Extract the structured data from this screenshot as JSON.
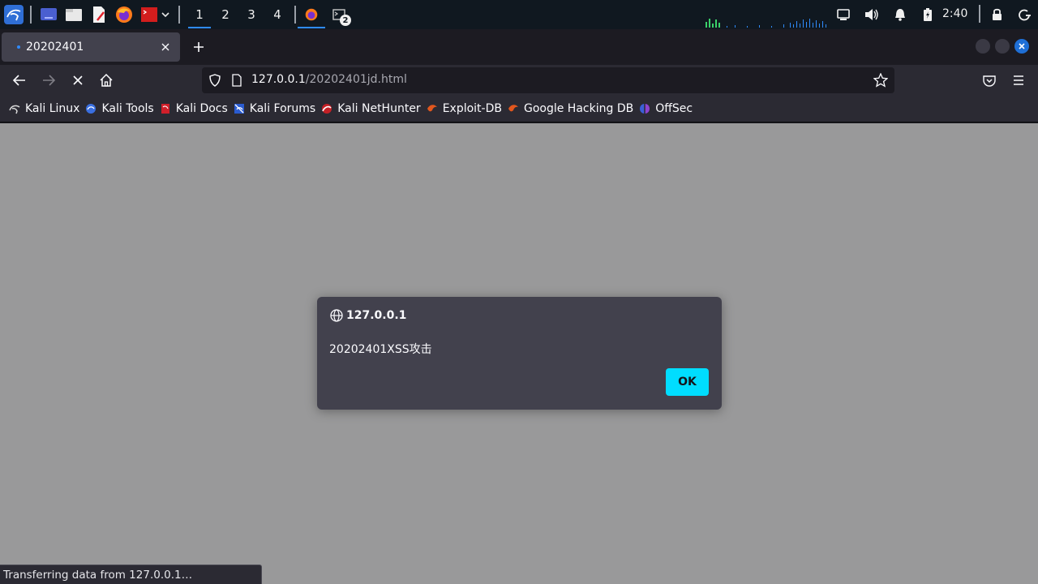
{
  "taskbar": {
    "workspaces": [
      "1",
      "2",
      "3",
      "4"
    ],
    "active_workspace": "1",
    "terminal_badge": "2",
    "clock": "2:40",
    "accent": "#2f8bff",
    "launcher_icons": [
      "kali-menu-icon",
      "show-desktop-icon",
      "file-manager-icon",
      "text-editor-icon",
      "firefox-icon",
      "terminal-icon",
      "chevron-down-icon"
    ],
    "tray_icons": [
      "network-icon",
      "volume-icon",
      "notification-bell-icon",
      "battery-icon",
      "lock-icon",
      "logout-icon"
    ]
  },
  "browser": {
    "tab": {
      "title": "20202401",
      "loading": true
    },
    "url": {
      "host": "127.0.0.1",
      "path": "/20202401jd.html"
    },
    "bookmarks": [
      {
        "label": "Kali Linux",
        "icon": "kali-dragon-icon"
      },
      {
        "label": "Kali Tools",
        "icon": "kali-tools-icon"
      },
      {
        "label": "Kali Docs",
        "icon": "kali-docs-icon"
      },
      {
        "label": "Kali Forums",
        "icon": "kali-forums-icon"
      },
      {
        "label": "Kali NetHunter",
        "icon": "kali-nethunter-icon"
      },
      {
        "label": "Exploit-DB",
        "icon": "exploit-db-icon"
      },
      {
        "label": "Google Hacking DB",
        "icon": "ghdb-icon"
      },
      {
        "label": "OffSec",
        "icon": "offsec-icon"
      }
    ],
    "status_text": "Transferring data from 127.0.0.1…"
  },
  "dialog": {
    "origin": "127.0.0.1",
    "message": "20202401XSS攻击",
    "ok_label": "OK",
    "ok_color": "#00ddff"
  }
}
